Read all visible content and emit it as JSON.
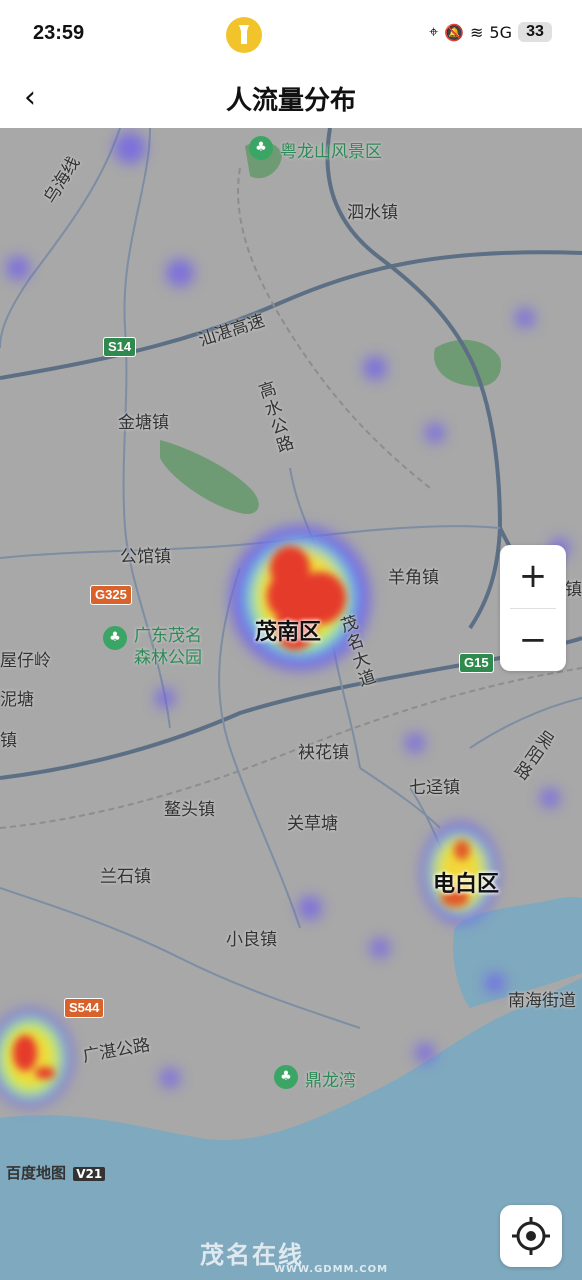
{
  "status_bar": {
    "time": "23:59",
    "battery": "33",
    "signal": "5G",
    "icons": [
      "location-icon",
      "mute-icon",
      "wifi-icon",
      "signal-icon",
      "battery-icon"
    ]
  },
  "nav": {
    "back_icon": "‹",
    "title": "人流量分布"
  },
  "map": {
    "places": [
      "粤龙山风景区",
      "泗水镇",
      "乌海线",
      "汕湛高速",
      "金塘镇",
      "高水公路",
      "公馆镇",
      "广东茂名",
      "森林公园",
      "屋仔岭",
      "泥塘",
      "镇",
      "茂南区",
      "茂名大道",
      "羊角镇",
      "袂花镇",
      "七迳镇",
      "鳌头镇",
      "关草塘",
      "兰石镇",
      "电白区",
      "小良镇",
      "南海街道",
      "广湛公路",
      "鼎龙湾",
      "吴阳路",
      "镇"
    ],
    "road_shields": [
      "S14",
      "G325",
      "G15",
      "S544"
    ],
    "credit": "百度地图",
    "credit_badge": "V21",
    "watermark": "茂名在线",
    "watermark_sub": "WWW.GDMM.COM",
    "colors": {
      "land": "#a8a8a8",
      "water": "#7fa9be",
      "road": "#5d6f84",
      "heat_low": "#6d5cf0",
      "heat_mid": "#a7ff4a",
      "heat_high": "#e53a2a"
    }
  },
  "zoom": {
    "in_label": "+",
    "out_label": "−"
  }
}
